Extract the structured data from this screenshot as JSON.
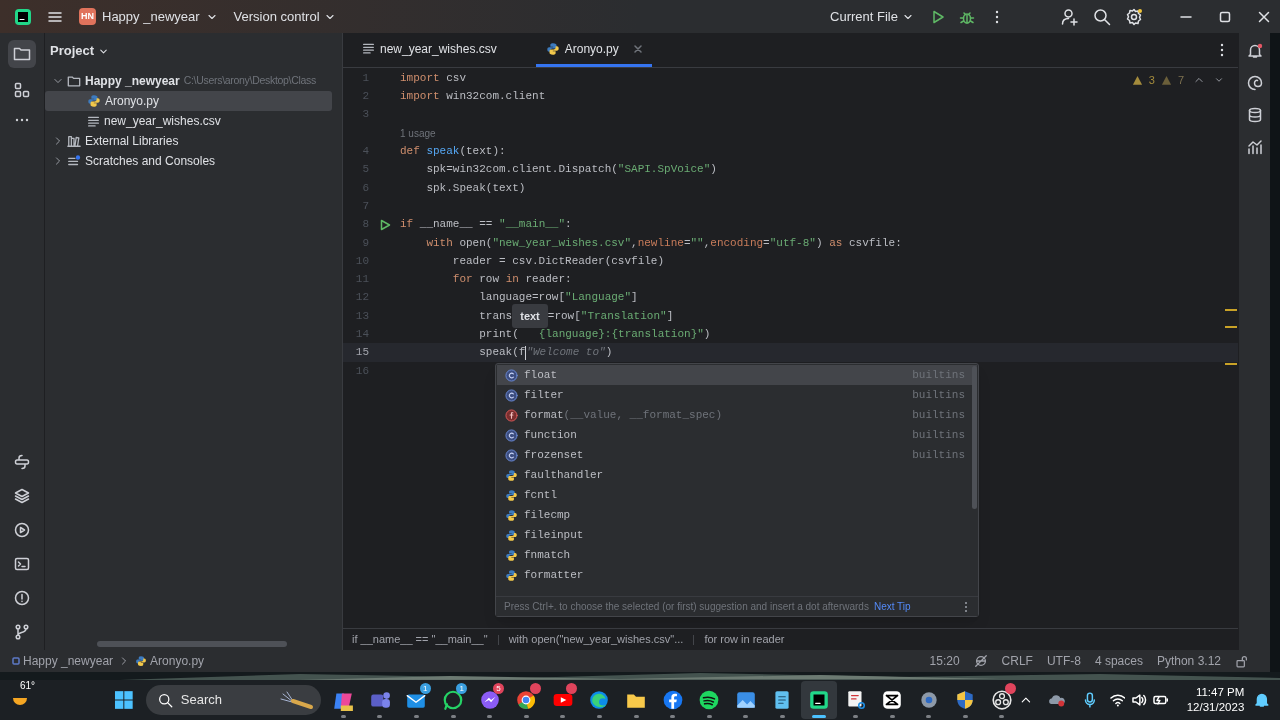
{
  "titlebar": {
    "project_badge": "HN",
    "project": "Happy _newyear",
    "vcs": "Version control",
    "run_config": "Current File"
  },
  "project_panel": {
    "title": "Project",
    "tree": [
      {
        "label": "Happy _newyear",
        "path": "C:\\Users\\arony\\Desktop\\Class",
        "kind": "folder",
        "expanded": true,
        "selected": false,
        "children": [
          {
            "label": "Aronyo.py",
            "kind": "python",
            "selected": true
          },
          {
            "label": "new_year_wishes.csv",
            "kind": "text",
            "selected": false
          }
        ]
      },
      {
        "label": "External Libraries",
        "kind": "library",
        "expanded": false,
        "selected": false
      },
      {
        "label": "Scratches and Consoles",
        "kind": "scratch",
        "expanded": false,
        "selected": false
      }
    ]
  },
  "editor": {
    "tabs": [
      {
        "label": "new_year_wishes.csv",
        "kind": "text",
        "selected": false
      },
      {
        "label": "Aronyo.py",
        "kind": "python",
        "selected": true
      }
    ],
    "problems": {
      "warnings": "3",
      "weak_warnings": "7"
    },
    "lines": [
      {
        "number": "1",
        "tokens": [
          {
            "kind": "kw",
            "text": "import"
          },
          {
            "kind": "plain",
            "text": " csv"
          }
        ]
      },
      {
        "number": "2",
        "tokens": [
          {
            "kind": "kw",
            "text": "import"
          },
          {
            "kind": "plain",
            "text": " win32com.client"
          }
        ]
      },
      {
        "number": "3"
      },
      {
        "kind": "inlay",
        "text": "1 usage"
      },
      {
        "number": "4",
        "tokens": [
          {
            "kind": "kw",
            "text": "def"
          },
          {
            "kind": "fn",
            "text": " speak"
          },
          {
            "kind": "plain",
            "text": "(text):"
          }
        ]
      },
      {
        "number": "5",
        "tokens": [
          {
            "kind": "plain",
            "text": "    spk=win32com.client.Dispatch("
          },
          {
            "kind": "str",
            "text": "\"SAPI.SpVoice\""
          },
          {
            "kind": "plain",
            "text": ")"
          }
        ]
      },
      {
        "number": "6",
        "tokens": [
          {
            "kind": "plain",
            "text": "    spk.Speak(text)"
          }
        ]
      },
      {
        "number": "7"
      },
      {
        "number": "8",
        "run": true,
        "tokens": [
          {
            "kind": "kw",
            "text": "if"
          },
          {
            "kind": "plain",
            "text": " __name__ == "
          },
          {
            "kind": "str",
            "text": "\"__main__\""
          },
          {
            "kind": "plain",
            "text": ":"
          }
        ]
      },
      {
        "number": "9",
        "tokens": [
          {
            "kind": "kw",
            "text": "    with"
          },
          {
            "kind": "plain",
            "text": " open("
          },
          {
            "kind": "str",
            "text": "\"new_year_wishes.csv\""
          },
          {
            "kind": "plain",
            "text": ","
          },
          {
            "kind": "param",
            "text": "newline"
          },
          {
            "kind": "plain",
            "text": "="
          },
          {
            "kind": "str",
            "text": "\"\""
          },
          {
            "kind": "plain",
            "text": ","
          },
          {
            "kind": "param",
            "text": "encoding"
          },
          {
            "kind": "plain",
            "text": "="
          },
          {
            "kind": "str",
            "text": "\"utf-8\""
          },
          {
            "kind": "plain",
            "text": ") "
          },
          {
            "kind": "kw",
            "text": "as"
          },
          {
            "kind": "plain",
            "text": " csvfile:"
          }
        ]
      },
      {
        "number": "10",
        "tokens": [
          {
            "kind": "plain",
            "text": "        reader = csv.DictReader(csvfile)"
          }
        ]
      },
      {
        "number": "11",
        "tokens": [
          {
            "kind": "kw",
            "text": "        for"
          },
          {
            "kind": "plain",
            "text": " row "
          },
          {
            "kind": "kw",
            "text": "in"
          },
          {
            "kind": "plain",
            "text": " reader:"
          }
        ]
      },
      {
        "number": "12",
        "tokens": [
          {
            "kind": "plain",
            "text": "            language=row["
          },
          {
            "kind": "str",
            "text": "\"Language\""
          },
          {
            "kind": "plain",
            "text": "]"
          }
        ]
      },
      {
        "number": "13",
        "tokens": [
          {
            "kind": "plain",
            "text": "            trans"
          },
          {
            "kind": "tooltip",
            "text": "text"
          },
          {
            "kind": "plain",
            "text": "=row["
          },
          {
            "kind": "str",
            "text": "\"Translation\""
          },
          {
            "kind": "plain",
            "text": "]"
          }
        ]
      },
      {
        "number": "14",
        "tokens": [
          {
            "kind": "plain",
            "text": "            print("
          },
          {
            "kind": "covered"
          },
          {
            "kind": "str",
            "text": "{language}:{translation}\""
          },
          {
            "kind": "plain",
            "text": ")"
          }
        ]
      },
      {
        "number": "15",
        "current": true,
        "tokens": [
          {
            "kind": "plain",
            "text": "            speak(f"
          },
          {
            "kind": "caret"
          },
          {
            "kind": "ghost",
            "text": "\"Welcome to\""
          },
          {
            "kind": "plain",
            "text": ")"
          }
        ]
      },
      {
        "number": "16"
      }
    ],
    "completion": {
      "items": [
        {
          "kind": "class",
          "name": "float",
          "source": "builtins",
          "selected": true
        },
        {
          "kind": "class",
          "name": "filter",
          "source": "builtins",
          "selected": false
        },
        {
          "kind": "function",
          "name": "format",
          "params": "(__value, __format_spec)",
          "source": "builtins",
          "selected": false
        },
        {
          "kind": "class",
          "name": "function",
          "source": "builtins",
          "selected": false
        },
        {
          "kind": "class",
          "name": "frozenset",
          "source": "builtins",
          "selected": false
        },
        {
          "kind": "module",
          "name": "faulthandler",
          "selected": false
        },
        {
          "kind": "module",
          "name": "fcntl",
          "selected": false
        },
        {
          "kind": "module",
          "name": "filecmp",
          "selected": false
        },
        {
          "kind": "module",
          "name": "fileinput",
          "selected": false
        },
        {
          "kind": "module",
          "name": "fnmatch",
          "selected": false
        },
        {
          "kind": "module",
          "name": "formatter",
          "selected": false
        }
      ],
      "hint": "Press Ctrl+. to choose the selected (or first) suggestion and insert a dot afterwards",
      "next_tip": "Next Tip"
    },
    "breadcrumbs": [
      "if __name__ == \"__main__\"",
      "with open(\"new_year_wishes.csv\"...",
      "for row in reader"
    ]
  },
  "status_bar": {
    "path": [
      "Happy _newyear",
      "Aronyo.py"
    ],
    "position": "15:20",
    "line_separator": "CRLF",
    "encoding": "UTF-8",
    "indent": "4 spaces",
    "interpreter": "Python 3.12"
  },
  "taskbar": {
    "weather": "61°",
    "search": "Search",
    "apps": [
      {
        "kind": "copilot",
        "active": false,
        "notify": false
      },
      {
        "kind": "teams",
        "active": false,
        "notify": false
      },
      {
        "kind": "mail",
        "badge": "1",
        "active": false,
        "notify": true
      },
      {
        "kind": "whatsapp",
        "badge": "1",
        "active": false,
        "notify": true
      },
      {
        "kind": "messenger",
        "badge": "5",
        "active": false,
        "notify": true
      },
      {
        "kind": "chrome",
        "active": false,
        "notify": true
      },
      {
        "kind": "youtube",
        "active": false,
        "notify": true
      },
      {
        "kind": "edge",
        "active": false,
        "notify": false
      },
      {
        "kind": "folder",
        "active": false,
        "notify": false
      },
      {
        "kind": "facebook",
        "active": false,
        "notify": false
      },
      {
        "kind": "spotify",
        "active": false,
        "notify": false
      },
      {
        "kind": "photos",
        "active": false,
        "notify": false
      },
      {
        "kind": "notepad",
        "active": false,
        "notify": false
      },
      {
        "kind": "pycharm",
        "active": true,
        "notify": false
      },
      {
        "kind": "snipping",
        "active": false,
        "notify": false
      },
      {
        "kind": "capcut",
        "active": false,
        "notify": false
      },
      {
        "kind": "settings",
        "active": false,
        "notify": false
      },
      {
        "kind": "security",
        "active": false,
        "notify": false
      },
      {
        "kind": "obs",
        "active": false,
        "notify": true
      }
    ],
    "time": "11:47 PM",
    "date": "12/31/2023"
  }
}
